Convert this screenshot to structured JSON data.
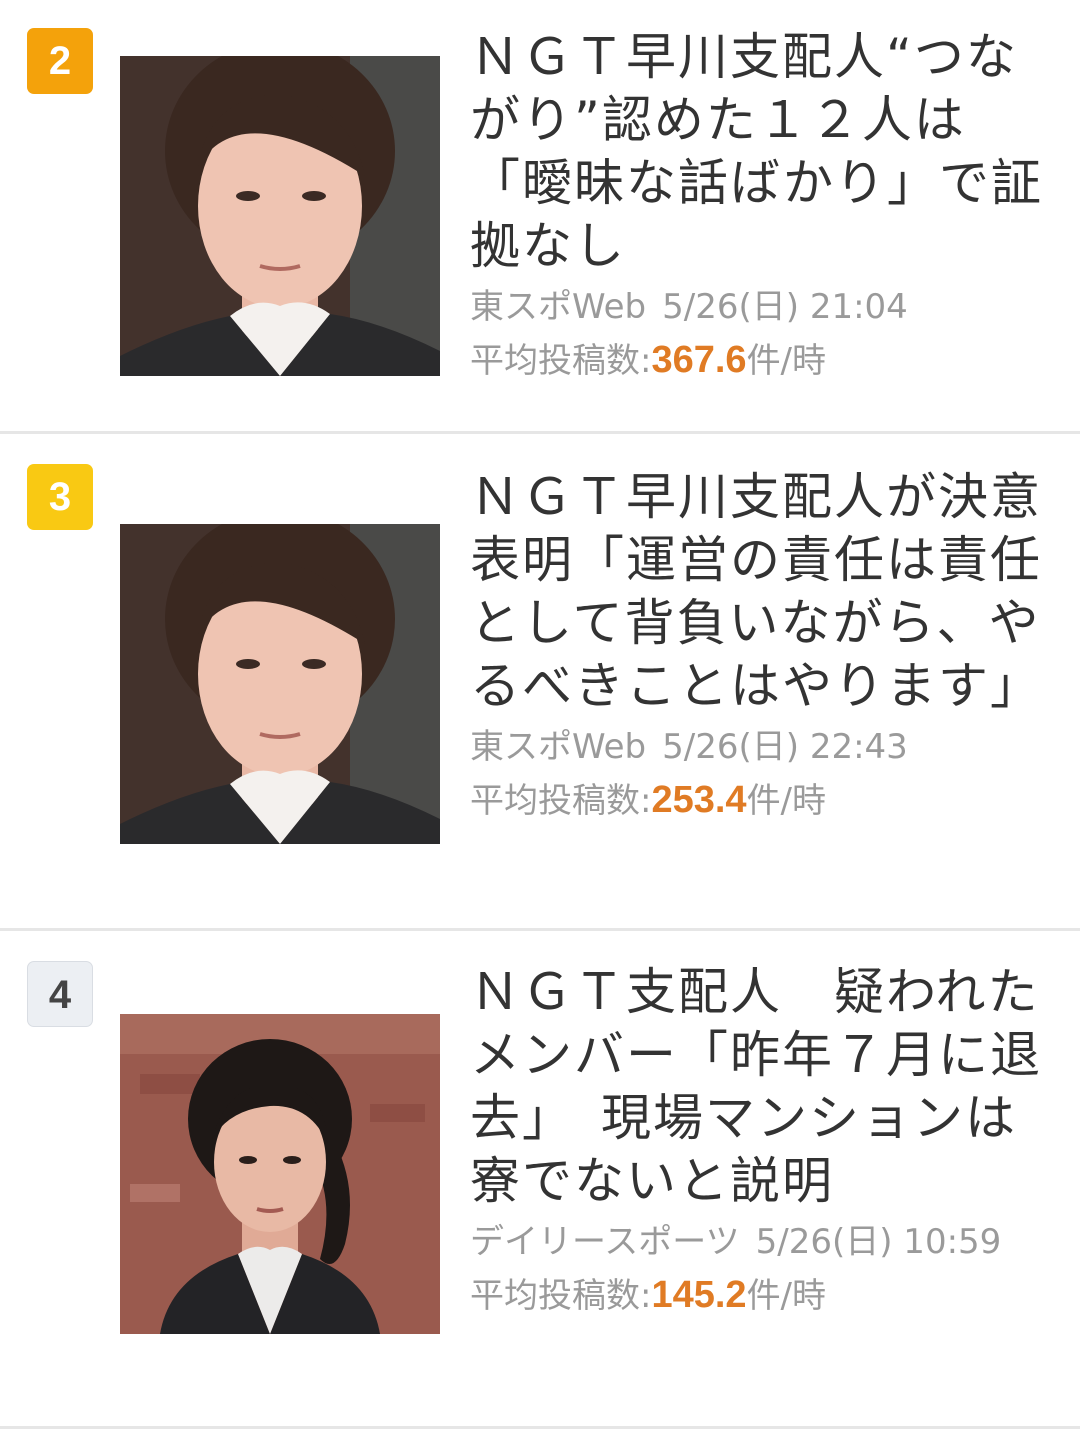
{
  "articles": [
    {
      "rank": "2",
      "title": "ＮＧＴ早川支配人“つながり”認めた１２人は「曖昧な話ばかり」で証拠なし",
      "source": "東スポWeb",
      "date": "5/26(日) 21:04",
      "stat_label": "平均投稿数:",
      "stat_value": "367.6",
      "stat_unit": "件/時",
      "thumb_icon": "portrait-photo"
    },
    {
      "rank": "3",
      "title": "ＮＧＴ早川支配人が決意表明「運営の責任は責任として背負いながら、やるべきことはやります」",
      "source": "東スポWeb",
      "date": "5/26(日) 22:43",
      "stat_label": "平均投稿数:",
      "stat_value": "253.4",
      "stat_unit": "件/時",
      "thumb_icon": "portrait-photo"
    },
    {
      "rank": "4",
      "title": "ＮＧＴ支配人　疑われたメンバー「昨年７月に退去」　現場マンションは寮でないと説明",
      "source": "デイリースポーツ",
      "date": "5/26(日) 10:59",
      "stat_label": "平均投稿数:",
      "stat_value": "145.2",
      "stat_unit": "件/時",
      "thumb_icon": "portrait-photo"
    }
  ],
  "colors": {
    "rank_2": "#f4a20b",
    "rank_3": "#f9c913",
    "rank_4": "#eceff3",
    "stat_value": "#e07b24",
    "meta_text": "#9a9a9a"
  }
}
